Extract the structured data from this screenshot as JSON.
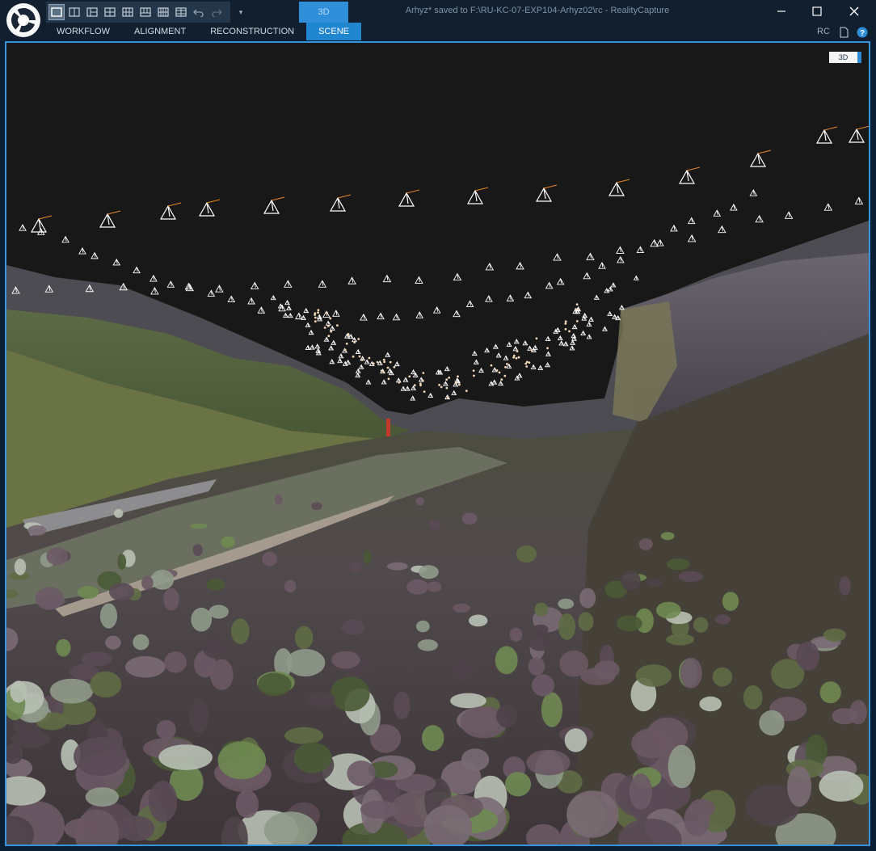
{
  "app": {
    "title": "Arhyz* saved to F:\\RU-KC-07-EXP104-Arhyz02\\rc - RealityCapture",
    "logo_icon": "realitycapture-logo-icon"
  },
  "layout_buttons": [
    "layout-1-icon",
    "layout-2-icon",
    "layout-3-icon",
    "layout-4-icon",
    "layout-5-icon",
    "layout-6-icon",
    "layout-7-icon",
    "layout-8-icon",
    "undo-icon",
    "redo-icon"
  ],
  "top_tab": {
    "label": "3D"
  },
  "ribbon": {
    "tabs": [
      {
        "label": "WORKFLOW",
        "active": false
      },
      {
        "label": "ALIGNMENT",
        "active": false
      },
      {
        "label": "RECONSTRUCTION",
        "active": false
      },
      {
        "label": "SCENE",
        "active": true
      }
    ],
    "rc_label": "RC"
  },
  "window_controls": [
    "minimize-icon",
    "maximize-icon",
    "close-icon"
  ],
  "viewport": {
    "badge": "3D",
    "content": "3d-scene"
  },
  "colors": {
    "accent": "#1f86cf",
    "titlebar": "#111f2e",
    "viewport_bg": "#181818",
    "camera_white": "#ffffff",
    "camera_orange": "#e8862c"
  }
}
